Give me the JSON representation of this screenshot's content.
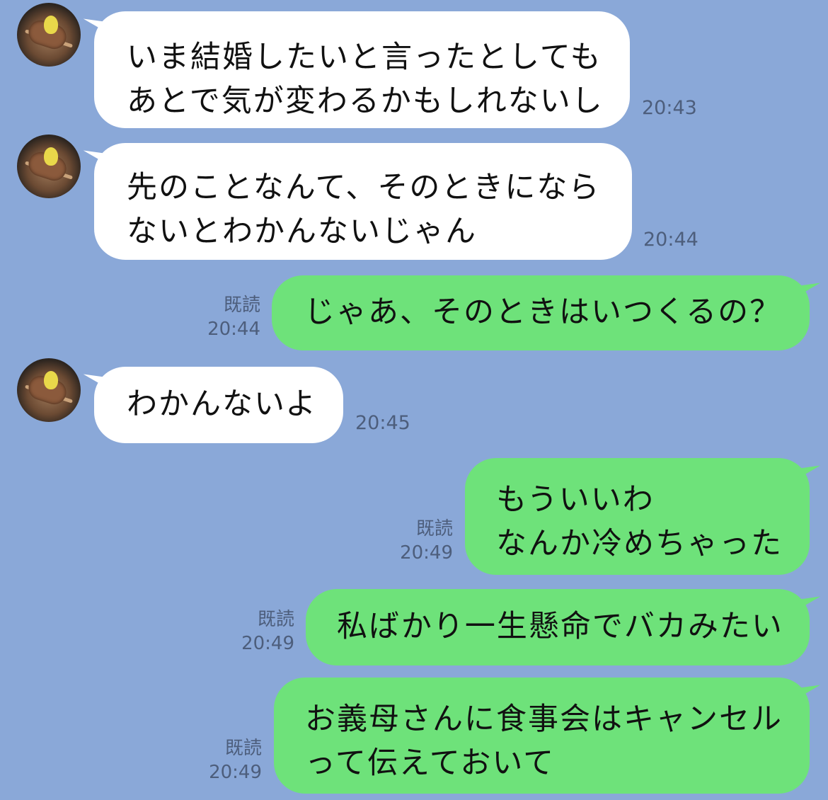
{
  "messages": [
    {
      "lines": [
        "いま結婚したいと言ったとしても",
        "あとで気が変わるかもしれないし"
      ],
      "time": "20:43"
    },
    {
      "lines": [
        "先のことなんて、そのときになら",
        "ないとわかんないじゃん"
      ],
      "time": "20:44"
    },
    {
      "lines": [
        "じゃあ、そのときはいつくるの？"
      ],
      "read": "既読",
      "time": "20:44"
    },
    {
      "lines": [
        "わかんないよ"
      ],
      "time": "20:45"
    },
    {
      "lines": [
        "もういいわ",
        "なんか冷めちゃった"
      ],
      "read": "既読",
      "time": "20:49"
    },
    {
      "lines": [
        "私ばかり一生懸命でバカみたい"
      ],
      "read": "既読",
      "time": "20:49"
    },
    {
      "lines": [
        "お義母さんに食事会はキャンセル",
        "って伝えておいて"
      ],
      "read": "既読",
      "time": "20:49"
    }
  ],
  "avatar_icon": "yakitori-avatar-icon",
  "colors": {
    "background": "#8aa8d8",
    "incoming": "#ffffff",
    "outgoing": "#6ee27a"
  }
}
